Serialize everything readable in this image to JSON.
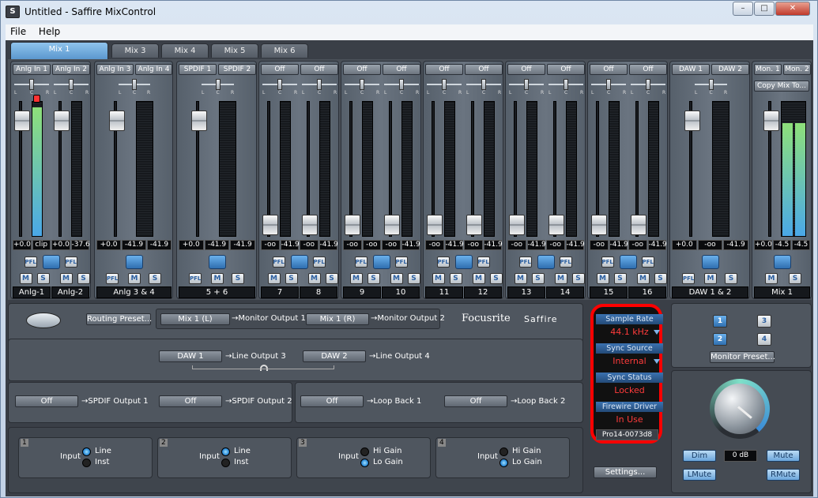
{
  "window": {
    "title": "Untitled - Saffire MixControl",
    "min": "–",
    "max": "□",
    "close": "✕",
    "icon": "S"
  },
  "menu": [
    "File",
    "Help"
  ],
  "tabs": [
    "Mix 1",
    "Mix 3",
    "Mix 4",
    "Mix 5",
    "Mix 6"
  ],
  "strips": [
    {
      "src": [
        "Anlg In 1",
        "Anlg In 2"
      ],
      "pfl": [
        "PFL",
        "PFL"
      ],
      "vals": [
        "+0.0",
        "clip",
        "+0.0",
        "-37.6"
      ],
      "names": [
        "Anlg-1",
        "Anlg-2"
      ]
    },
    {
      "src": [
        "Anlg In 3",
        "Anlg In 4"
      ],
      "pfl": [
        "PFL"
      ],
      "vals": [
        "+0.0",
        "-41.9",
        "-41.9"
      ],
      "names": [
        "Anlg 3 & 4"
      ]
    },
    {
      "src": [
        "SPDIF 1",
        "SPDIF 2"
      ],
      "pfl": [
        "PFL"
      ],
      "vals": [
        "+0.0",
        "-41.9",
        "-41.9"
      ],
      "names": [
        "5 + 6"
      ]
    },
    {
      "src": [
        "Off",
        "Off"
      ],
      "pfl": [
        "PFL",
        "PFL"
      ],
      "vals": [
        "-oo",
        "-41.9",
        "-oo",
        "-41.9"
      ],
      "names": [
        "7",
        "8"
      ]
    },
    {
      "src": [
        "Off",
        "Off"
      ],
      "pfl": [
        "PFL",
        "PFL"
      ],
      "vals": [
        "-oo",
        "-oo",
        "-oo",
        "-41.9"
      ],
      "names": [
        "9",
        "10"
      ]
    },
    {
      "src": [
        "Off",
        "Off"
      ],
      "pfl": [
        "PFL",
        "PFL"
      ],
      "vals": [
        "-oo",
        "-41.9",
        "-oo",
        "-41.9"
      ],
      "names": [
        "11",
        "12"
      ]
    },
    {
      "src": [
        "Off",
        "Off"
      ],
      "pfl": [
        "PFL",
        "PFL"
      ],
      "vals": [
        "-oo",
        "-41.9",
        "-oo",
        "-41.9"
      ],
      "names": [
        "13",
        "14"
      ]
    },
    {
      "src": [
        "Off",
        "Off"
      ],
      "pfl": [
        "PFL",
        "PFL"
      ],
      "vals": [
        "-oo",
        "-41.9",
        "-oo",
        "-41.9"
      ],
      "names": [
        "15",
        "16"
      ]
    },
    {
      "src": [
        "DAW 1",
        "DAW 2"
      ],
      "pfl": [
        "PFL"
      ],
      "vals": [
        "+0.0",
        "-oo",
        "-41.9"
      ],
      "names": [
        "DAW 1 & 2"
      ]
    },
    {
      "src": [
        "Mon. 1",
        "Mon. 2"
      ],
      "pfl": [],
      "vals": [
        "+0.0",
        "-4.5",
        "-4.5"
      ],
      "names": [
        "Mix 1"
      ]
    }
  ],
  "mute_label": "M",
  "solo_label": "S",
  "pan_labels": {
    "l": "L",
    "c": "C",
    "r": "R"
  },
  "copy_mix": "Copy Mix To...",
  "routing": {
    "preset": "Routing Preset...",
    "brand1": "Focusrite",
    "brand2": "Saffire",
    "rows": [
      [
        {
          "src": "Mix 1 (L)",
          "dst": "→Monitor Output 1"
        },
        {
          "src": "Mix 1 (R)",
          "dst": "→Monitor Output 2"
        }
      ],
      [
        {
          "src": "DAW 1",
          "dst": "→Line Output 3"
        },
        {
          "src": "DAW 2",
          "dst": "→Line Output 4"
        }
      ],
      [
        {
          "src": "Off",
          "dst": "→SPDIF Output 1"
        },
        {
          "src": "Off",
          "dst": "→SPDIF Output 2"
        },
        {
          "src": "Off",
          "dst": "→Loop Back 1"
        },
        {
          "src": "Off",
          "dst": "→Loop Back 2"
        }
      ]
    ]
  },
  "inputs": [
    {
      "num": "1",
      "label": "Input",
      "opts": [
        "Line",
        "Inst"
      ],
      "sel": 0
    },
    {
      "num": "2",
      "label": "Input",
      "opts": [
        "Line",
        "Inst"
      ],
      "sel": 0
    },
    {
      "num": "3",
      "label": "Input",
      "opts": [
        "Hi Gain",
        "Lo Gain"
      ],
      "sel": 1
    },
    {
      "num": "4",
      "label": "Input",
      "opts": [
        "Hi Gain",
        "Lo Gain"
      ],
      "sel": 1
    }
  ],
  "sync": {
    "sample_rate_label": "Sample Rate",
    "sample_rate": "44.1 kHz",
    "source_label": "Sync Source",
    "source": "Internal",
    "status_label": "Sync Status",
    "status": "Locked",
    "driver_label": "Firewire Driver",
    "driver": "In Use",
    "device": "Pro14-0073d8",
    "settings": "Settings..."
  },
  "monitor": {
    "buttons": [
      "1",
      "2",
      "3",
      "4"
    ],
    "preset": "Monitor Preset...",
    "dim": "Dim",
    "level": "0 dB",
    "mute": "Mute",
    "lmute": "LMute",
    "rmute": "RMute"
  },
  "colors": {
    "accent": "#5b98cf",
    "meter_green": "#8ee07a",
    "meter_blue": "#4aa8e8",
    "alert": "#ff3b3b",
    "highlight_ring": "#ff0000"
  }
}
